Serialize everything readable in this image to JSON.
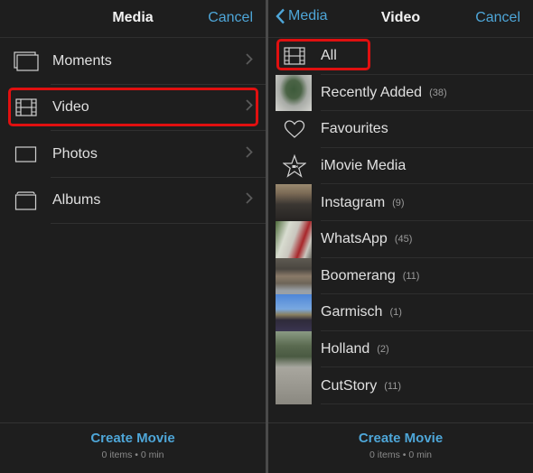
{
  "left_panel": {
    "title": "Media",
    "cancel_label": "Cancel",
    "items": [
      {
        "label": "Moments",
        "icon": "moments-icon"
      },
      {
        "label": "Video",
        "icon": "film-icon",
        "highlighted": true
      },
      {
        "label": "Photos",
        "icon": "photo-icon"
      },
      {
        "label": "Albums",
        "icon": "albums-icon"
      }
    ],
    "footer": {
      "create_label": "Create Movie",
      "summary": "0 items • 0 min"
    }
  },
  "right_panel": {
    "back_label": "Media",
    "title": "Video",
    "cancel_label": "Cancel",
    "items": [
      {
        "label": "All",
        "count": "",
        "icon": "film-icon",
        "highlighted": true
      },
      {
        "label": "Recently Added",
        "count": "(38)",
        "thumb": "tree"
      },
      {
        "label": "Favourites",
        "count": "",
        "icon": "heart-icon"
      },
      {
        "label": "iMovie Media",
        "count": "",
        "icon": "star-icon"
      },
      {
        "label": "Instagram",
        "count": "(9)",
        "thumb": "street"
      },
      {
        "label": "WhatsApp",
        "count": "(45)",
        "thumb": "crowd"
      },
      {
        "label": "Boomerang",
        "count": "(11)",
        "thumb": "stadium"
      },
      {
        "label": "Garmisch",
        "count": "(1)",
        "thumb": "sky"
      },
      {
        "label": "Holland",
        "count": "(2)",
        "thumb": "garden"
      },
      {
        "label": "CutStory",
        "count": "(11)",
        "thumb": "path"
      }
    ],
    "footer": {
      "create_label": "Create Movie",
      "summary": "0 items • 0 min"
    }
  },
  "colors": {
    "accent": "#4ea6d8",
    "highlight": "#e01010",
    "background": "#1e1e1e"
  }
}
